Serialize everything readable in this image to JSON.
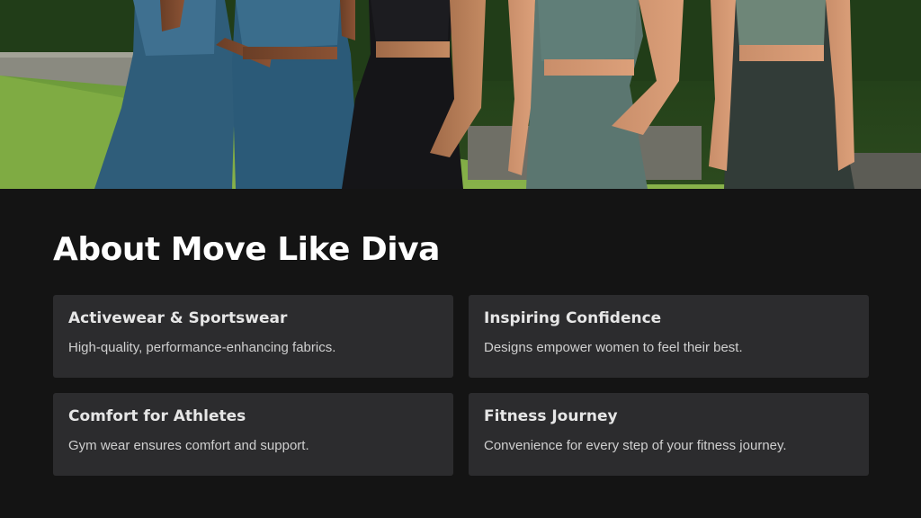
{
  "hero": {
    "image": "activewear-models-photo"
  },
  "about": {
    "title": "About Move Like Diva",
    "cards": [
      {
        "title": "Activewear & Sportswear",
        "description": "High-quality, performance-enhancing fabrics."
      },
      {
        "title": "Inspiring Confidence",
        "description": "Designs empower women to feel their best."
      },
      {
        "title": "Comfort for Athletes",
        "description": "Gym wear ensures comfort and support."
      },
      {
        "title": "Fitness Journey",
        "description": "Convenience for every step of your fitness journey."
      }
    ]
  },
  "colors": {
    "background": "#141414",
    "card": "#2c2c2e",
    "title_text": "#ffffff",
    "card_title_text": "#e6e6e6",
    "card_desc_text": "#cfcfcf"
  }
}
